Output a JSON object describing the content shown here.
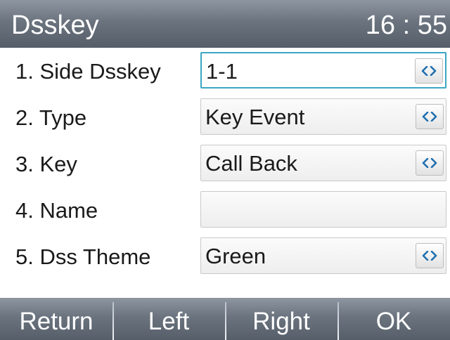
{
  "header": {
    "title": "Dsskey",
    "time": "16 : 55"
  },
  "rows": [
    {
      "label": "1.  Side Dsskey",
      "value": "1-1",
      "has_switch": true,
      "focused": true
    },
    {
      "label": "2.  Type",
      "value": "Key Event",
      "has_switch": true,
      "focused": false
    },
    {
      "label": "3.  Key",
      "value": "Call Back",
      "has_switch": true,
      "focused": false
    },
    {
      "label": "4.  Name",
      "value": "",
      "has_switch": false,
      "focused": false
    },
    {
      "label": "5.  Dss Theme",
      "value": "Green",
      "has_switch": true,
      "focused": false
    }
  ],
  "softkeys": [
    "Return",
    "Left",
    "Right",
    "OK"
  ],
  "icons": {
    "switch": "left-right-arrows-icon"
  },
  "colors": {
    "bar": "#6a737e",
    "focus": "#3aa6c4",
    "switch_arrows": "#1f6fb0"
  }
}
